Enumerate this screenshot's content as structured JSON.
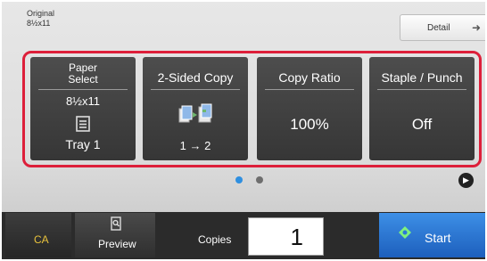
{
  "original": {
    "label": "Original",
    "size": "8½x11"
  },
  "detail": {
    "label": "Detail",
    "arrow_icon": "arrow-right-icon"
  },
  "tiles": [
    {
      "title": "Paper Select",
      "value": "8½x11",
      "sub": "Tray 1",
      "icon": "tray-icon"
    },
    {
      "title": "2-Sided Copy",
      "value": "1 → 2",
      "icon": "duplex-copy-icon"
    },
    {
      "title": "Copy Ratio",
      "value": "100%"
    },
    {
      "title": "Staple / Punch",
      "value": "Off"
    }
  ],
  "pager": {
    "pages": 2,
    "active": 1,
    "active_color": "#2f8fe0",
    "inactive_color": "#6e6e6e"
  },
  "bottom": {
    "ca_label": "CA",
    "preview_label": "Preview",
    "copies_label": "Copies",
    "copies_value": "1",
    "start_label": "Start"
  },
  "colors": {
    "highlight": "#dd1f3a",
    "tile_bg": "#3f3f3f",
    "ca_text": "#e8c23c",
    "start_bg": "#2a78d8"
  }
}
